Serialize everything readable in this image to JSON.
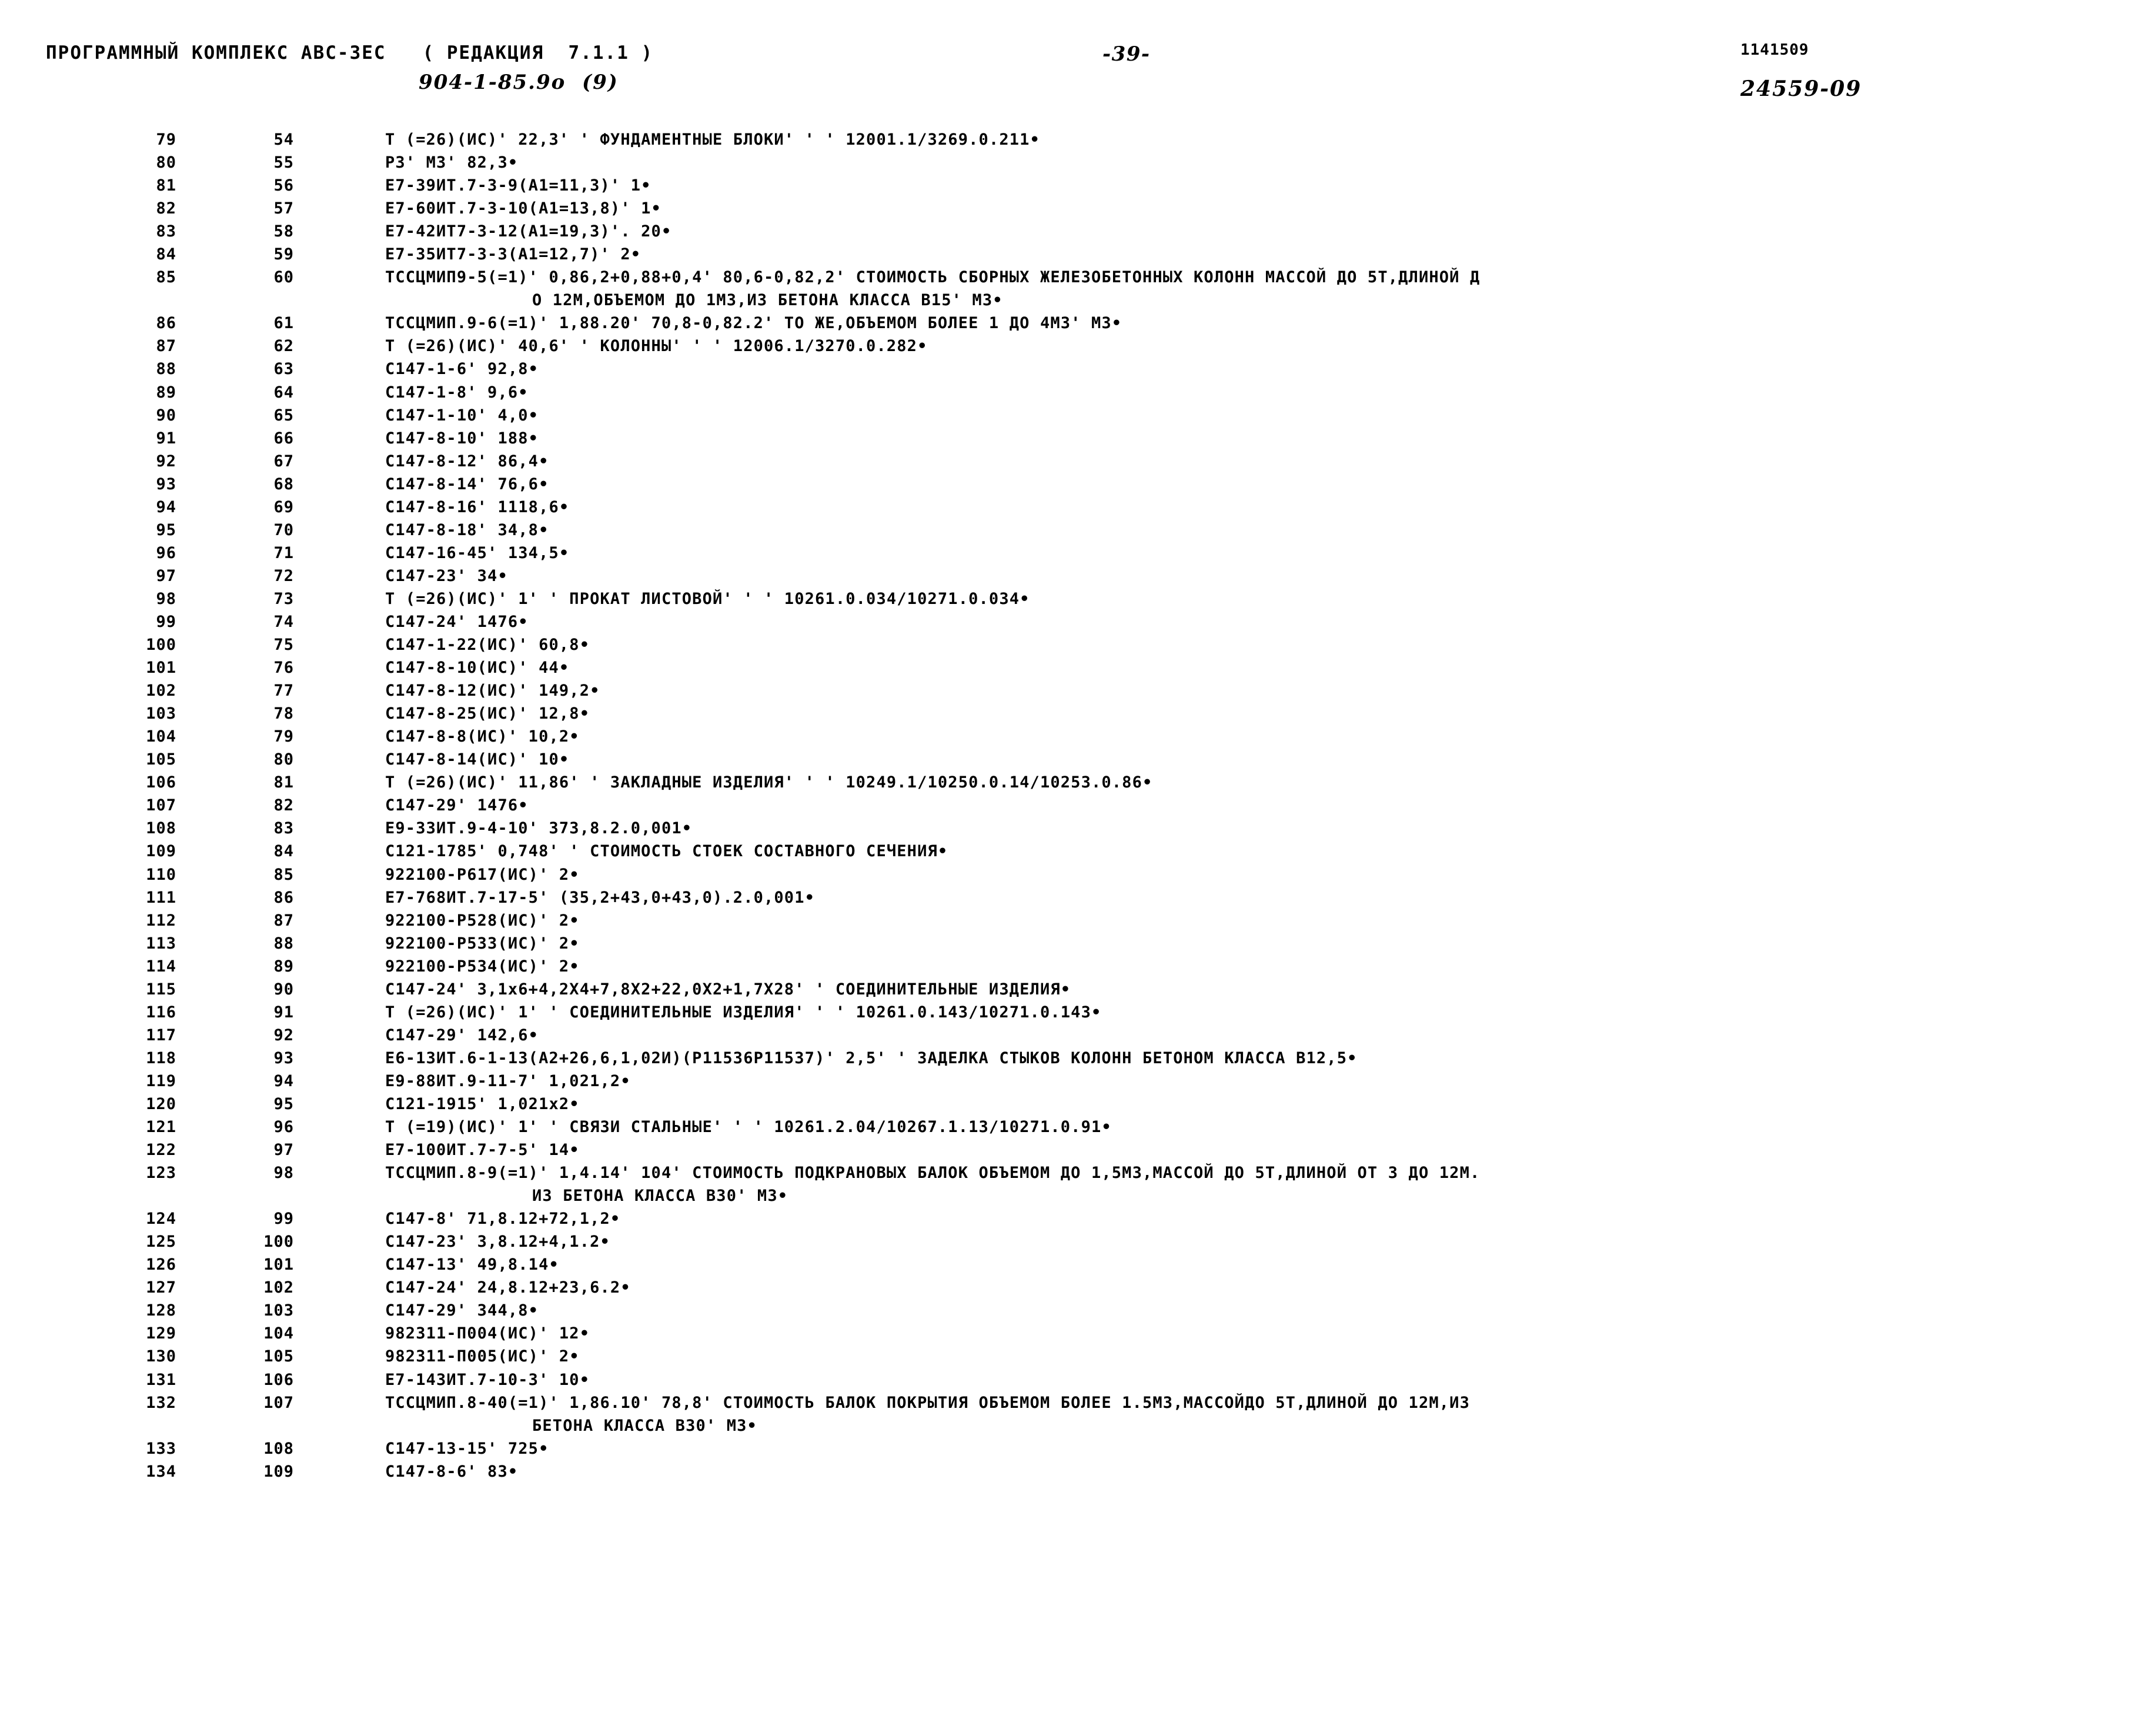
{
  "header": {
    "program_line": "ПРОГРАММНЫЙ КОМПЛЕКС АВС-3ЕС   ( РЕДАКЦИЯ  7.1.1 )",
    "doc_number": "904-1-85.9о  (9)",
    "page_number": "-39-",
    "code_top": "1141509",
    "code_bottom": "24559-09"
  },
  "listing": {
    "rows": [
      {
        "num": "79",
        "seq": "54",
        "text": "Т (=26)(ИС)' 22,3' ' ФУНДАМЕНТНЫЕ БЛОКИ' ' ' 12001.1/3269.0.211•"
      },
      {
        "num": "80",
        "seq": "55",
        "text": "Р3' М3' 82,3•"
      },
      {
        "num": "81",
        "seq": "56",
        "text": "Е7-39ИТ.7-3-9(А1=11,3)' 1•"
      },
      {
        "num": "82",
        "seq": "57",
        "text": "Е7-60ИТ.7-3-10(А1=13,8)' 1•"
      },
      {
        "num": "83",
        "seq": "58",
        "text": "Е7-42ИТ7-3-12(А1=19,3)'. 20•"
      },
      {
        "num": "84",
        "seq": "59",
        "text": "Е7-35ИТ7-3-3(А1=12,7)' 2•"
      },
      {
        "num": "85",
        "seq": "60",
        "text": "ТССЦМИП9-5(=1)' 0,86,2+0,88+0,4' 80,6-0,82,2' СТОИМОСТЬ СБОРНЫХ ЖЕЛЕЗОБЕТОННЫХ КОЛОНН МАССОЙ ДО 5Т,ДЛИНОЙ Д"
      },
      {
        "num": "",
        "seq": "",
        "indent": true,
        "text": "О 12М,ОБЪЕМОМ ДО 1М3,ИЗ БЕТОНА КЛАССА В15' М3•"
      },
      {
        "num": "86",
        "seq": "61",
        "text": "ТССЦМИП.9-6(=1)' 1,88.20' 70,8-0,82.2' ТО ЖЕ,ОБЪЕМОМ БОЛЕЕ 1 ДО 4М3' М3•"
      },
      {
        "num": "87",
        "seq": "62",
        "text": "Т (=26)(ИС)' 40,6' ' КОЛОННЫ' ' ' 12006.1/3270.0.282•"
      },
      {
        "num": "88",
        "seq": "63",
        "text": "С147-1-6' 92,8•"
      },
      {
        "num": "89",
        "seq": "64",
        "text": "С147-1-8' 9,6•"
      },
      {
        "num": "90",
        "seq": "65",
        "text": "С147-1-10' 4,0•"
      },
      {
        "num": "91",
        "seq": "66",
        "text": "С147-8-10' 188•"
      },
      {
        "num": "92",
        "seq": "67",
        "text": "С147-8-12' 86,4•"
      },
      {
        "num": "93",
        "seq": "68",
        "text": "С147-8-14' 76,6•"
      },
      {
        "num": "94",
        "seq": "69",
        "text": "С147-8-16' 1118,6•"
      },
      {
        "num": "95",
        "seq": "70",
        "text": "С147-8-18' 34,8•"
      },
      {
        "num": "96",
        "seq": "71",
        "text": "С147-16-45' 134,5•"
      },
      {
        "num": "97",
        "seq": "72",
        "text": "С147-23' 34•"
      },
      {
        "num": "98",
        "seq": "73",
        "text": "Т (=26)(ИС)' 1' ' ПРОКАТ ЛИСТОВОЙ' ' ' 10261.0.034/10271.0.034•"
      },
      {
        "num": "99",
        "seq": "74",
        "text": "С147-24' 1476•"
      },
      {
        "num": "100",
        "seq": "75",
        "text": "С147-1-22(ИС)' 60,8•"
      },
      {
        "num": "101",
        "seq": "76",
        "text": "С147-8-10(ИС)' 44•"
      },
      {
        "num": "102",
        "seq": "77",
        "text": "С147-8-12(ИС)' 149,2•"
      },
      {
        "num": "103",
        "seq": "78",
        "text": "С147-8-25(ИС)' 12,8•"
      },
      {
        "num": "104",
        "seq": "79",
        "text": "С147-8-8(ИС)' 10,2•"
      },
      {
        "num": "105",
        "seq": "80",
        "text": "С147-8-14(ИС)' 10•"
      },
      {
        "num": "106",
        "seq": "81",
        "text": "Т (=26)(ИС)' 11,86' ' ЗАКЛАДНЫЕ ИЗДЕЛИЯ' ' ' 10249.1/10250.0.14/10253.0.86•"
      },
      {
        "num": "107",
        "seq": "82",
        "text": "С147-29' 1476•"
      },
      {
        "num": "108",
        "seq": "83",
        "text": "Е9-33ИТ.9-4-10' 373,8.2.0,001•"
      },
      {
        "num": "109",
        "seq": "84",
        "text": "С121-1785' 0,748' ' СТОИМОСТЬ СТОЕК СОСТАВНОГО СЕЧЕНИЯ•"
      },
      {
        "num": "110",
        "seq": "85",
        "text": "922100-Р617(ИС)' 2•"
      },
      {
        "num": "111",
        "seq": "86",
        "text": "Е7-768ИТ.7-17-5' (35,2+43,0+43,0).2.0,001•"
      },
      {
        "num": "112",
        "seq": "87",
        "text": "922100-Р528(ИС)' 2•"
      },
      {
        "num": "113",
        "seq": "88",
        "text": "922100-Р533(ИС)' 2•"
      },
      {
        "num": "114",
        "seq": "89",
        "text": "922100-Р534(ИС)' 2•"
      },
      {
        "num": "115",
        "seq": "90",
        "text": "С147-24' 3,1х6+4,2Х4+7,8Х2+22,0Х2+1,7Х28' ' СОЕДИНИТЕЛЬНЫЕ ИЗДЕЛИЯ•"
      },
      {
        "num": "116",
        "seq": "91",
        "text": "Т (=26)(ИС)' 1' ' СОЕДИНИТЕЛЬНЫЕ ИЗДЕЛИЯ' ' ' 10261.0.143/10271.0.143•"
      },
      {
        "num": "117",
        "seq": "92",
        "text": "С147-29' 142,6•"
      },
      {
        "num": "118",
        "seq": "93",
        "text": "Е6-13ИТ.6-1-13(А2+26,6,1,02И)(Р11536Р11537)' 2,5' ' ЗАДЕЛКА СТЫКОВ КОЛОНН БЕТОНОМ КЛАССА В12,5•"
      },
      {
        "num": "119",
        "seq": "94",
        "text": "Е9-88ИТ.9-11-7' 1,021,2•"
      },
      {
        "num": "120",
        "seq": "95",
        "text": "С121-1915' 1,021х2•"
      },
      {
        "num": "121",
        "seq": "96",
        "text": "Т (=19)(ИС)' 1' ' СВЯЗИ СТАЛЬНЫЕ' ' ' 10261.2.04/10267.1.13/10271.0.91•"
      },
      {
        "num": "122",
        "seq": "97",
        "text": "Е7-100ИТ.7-7-5' 14•"
      },
      {
        "num": "123",
        "seq": "98",
        "text": "ТССЦМИП.8-9(=1)' 1,4.14' 104' СТОИМОСТЬ ПОДКРАНОВЫХ БАЛОК ОБЪЕМОМ ДО 1,5М3,МАССОЙ ДО 5Т,ДЛИНОЙ ОТ 3 ДО 12М."
      },
      {
        "num": "",
        "seq": "",
        "indent": true,
        "text": "ИЗ БЕТОНА КЛАССА В30' М3•"
      },
      {
        "num": "124",
        "seq": "99",
        "text": "С147-8' 71,8.12+72,1,2•"
      },
      {
        "num": "125",
        "seq": "100",
        "text": "С147-23' 3,8.12+4,1.2•"
      },
      {
        "num": "126",
        "seq": "101",
        "text": "С147-13' 49,8.14•"
      },
      {
        "num": "127",
        "seq": "102",
        "text": "С147-24' 24,8.12+23,6.2•"
      },
      {
        "num": "128",
        "seq": "103",
        "text": "С147-29' 344,8•"
      },
      {
        "num": "129",
        "seq": "104",
        "text": "982311-П004(ИС)' 12•"
      },
      {
        "num": "130",
        "seq": "105",
        "text": "982311-П005(ИС)' 2•"
      },
      {
        "num": "131",
        "seq": "106",
        "text": "Е7-143ИТ.7-10-3' 10•"
      },
      {
        "num": "132",
        "seq": "107",
        "text": "ТССЦМИП.8-40(=1)' 1,86.10' 78,8' СТОИМОСТЬ БАЛОК ПОКРЫТИЯ ОБЪЕМОМ БОЛЕЕ 1.5М3,МАССОЙДО 5Т,ДЛИНОЙ ДО 12М,ИЗ"
      },
      {
        "num": "",
        "seq": "",
        "indent": true,
        "text": "БЕТОНА КЛАССА В30' М3•"
      },
      {
        "num": "133",
        "seq": "108",
        "text": "С147-13-15' 725•"
      },
      {
        "num": "134",
        "seq": "109",
        "text": "С147-8-6' 83•"
      }
    ]
  }
}
